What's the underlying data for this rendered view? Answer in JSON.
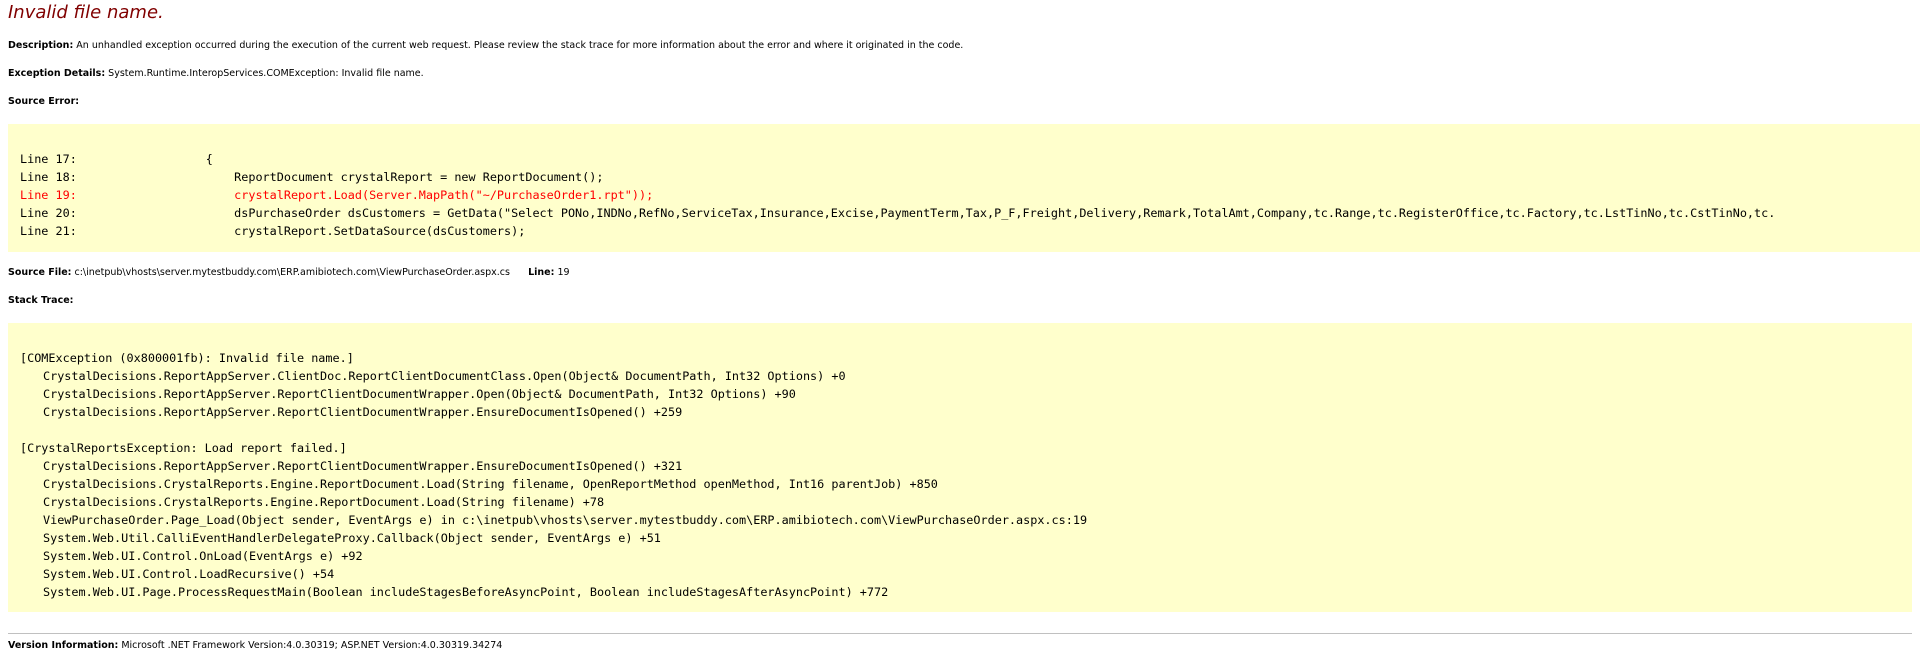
{
  "title": "Invalid file name.",
  "description": {
    "label": "Description:",
    "text": "An unhandled exception occurred during the execution of the current web request. Please review the stack trace for more information about the error and where it originated in the code."
  },
  "exception_details": {
    "label": "Exception Details:",
    "text": "System.Runtime.InteropServices.COMException: Invalid file name."
  },
  "source_error": {
    "label": "Source Error:",
    "lines": [
      {
        "num": "Line 17:",
        "code": "{",
        "indent": "       "
      },
      {
        "num": "Line 18:",
        "code": "ReportDocument crystalReport = new ReportDocument();",
        "indent": "           "
      },
      {
        "num": "Line 19:",
        "code": "crystalReport.Load(Server.MapPath(\"~/PurchaseOrder1.rpt\"));",
        "indent": "           ",
        "highlight": true
      },
      {
        "num": "Line 20:",
        "code": "dsPurchaseOrder dsCustomers = GetData(\"Select PONo,INDNo,RefNo,ServiceTax,Insurance,Excise,PaymentTerm,Tax,P_F,Freight,Delivery,Remark,TotalAmt,Company,tc.Range,tc.RegisterOffice,tc.Factory,tc.LstTinNo,tc.CstTinNo,tc.",
        "indent": "           "
      },
      {
        "num": "Line 21:",
        "code": "crystalReport.SetDataSource(dsCustomers);",
        "indent": "           "
      }
    ]
  },
  "source_file": {
    "label": "Source File:",
    "path": "c:\\inetpub\\vhosts\\server.mytestbuddy.com\\ERP.amibiotech.com\\ViewPurchaseOrder.aspx.cs",
    "line_label": "Line:",
    "line_value": "19"
  },
  "stack_trace": {
    "label": "Stack Trace:",
    "groups": [
      {
        "header": "[COMException (0x800001fb): Invalid file name.]",
        "frames": [
          "CrystalDecisions.ReportAppServer.ClientDoc.ReportClientDocumentClass.Open(Object& DocumentPath, Int32 Options) +0",
          "CrystalDecisions.ReportAppServer.ReportClientDocumentWrapper.Open(Object& DocumentPath, Int32 Options) +90",
          "CrystalDecisions.ReportAppServer.ReportClientDocumentWrapper.EnsureDocumentIsOpened() +259"
        ]
      },
      {
        "header": "[CrystalReportsException: Load report failed.]",
        "frames": [
          "CrystalDecisions.ReportAppServer.ReportClientDocumentWrapper.EnsureDocumentIsOpened() +321",
          "CrystalDecisions.CrystalReports.Engine.ReportDocument.Load(String filename, OpenReportMethod openMethod, Int16 parentJob) +850",
          "CrystalDecisions.CrystalReports.Engine.ReportDocument.Load(String filename) +78",
          "ViewPurchaseOrder.Page_Load(Object sender, EventArgs e) in c:\\inetpub\\vhosts\\server.mytestbuddy.com\\ERP.amibiotech.com\\ViewPurchaseOrder.aspx.cs:19",
          "System.Web.Util.CalliEventHandlerDelegateProxy.Callback(Object sender, EventArgs e) +51",
          "System.Web.UI.Control.OnLoad(EventArgs e) +92",
          "System.Web.UI.Control.LoadRecursive() +54",
          "System.Web.UI.Page.ProcessRequestMain(Boolean includeStagesBeforeAsyncPoint, Boolean includeStagesAfterAsyncPoint) +772"
        ]
      }
    ]
  },
  "version_info": {
    "label": "Version Information:",
    "text": "Microsoft .NET Framework Version:4.0.30319; ASP.NET Version:4.0.30319.34274"
  },
  "colors": {
    "title": "#800000",
    "code_background": "#ffffcc",
    "highlight_line": "#ff0000",
    "divider": "#c0c0c0"
  }
}
